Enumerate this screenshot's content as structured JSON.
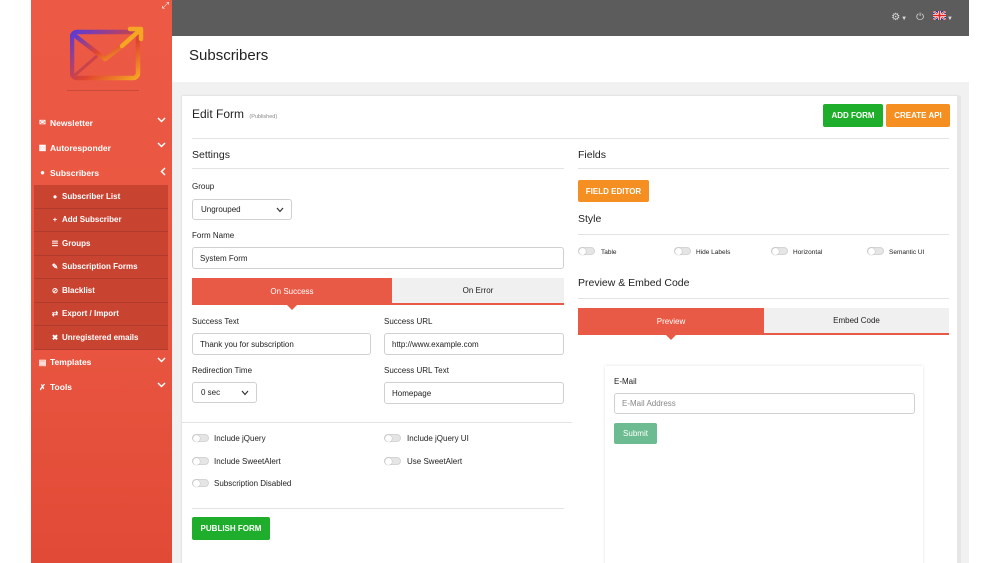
{
  "sidebar": {
    "nav": [
      {
        "label": "Newsletter",
        "icon": "envelope-icon"
      },
      {
        "label": "Autoresponder",
        "icon": "truck-icon"
      },
      {
        "label": "Subscribers",
        "icon": "users-icon"
      }
    ],
    "subscribers_sub": [
      {
        "label": "Subscriber List",
        "icon": "users-icon"
      },
      {
        "label": "Add Subscriber",
        "icon": "plus-icon"
      },
      {
        "label": "Groups",
        "icon": "list-icon"
      },
      {
        "label": "Subscription Forms",
        "icon": "edit-icon"
      },
      {
        "label": "Blacklist",
        "icon": "ban-icon"
      },
      {
        "label": "Export / Import",
        "icon": "exchange-icon"
      },
      {
        "label": "Unregistered emails",
        "icon": "user-times-icon"
      }
    ],
    "nav_after": [
      {
        "label": "Templates",
        "icon": "paint-roller-icon"
      },
      {
        "label": "Tools",
        "icon": "tools-icon"
      }
    ]
  },
  "page": {
    "title": "Subscribers"
  },
  "card": {
    "title": "Edit Form",
    "status": "(Published)",
    "add_form": "ADD FORM",
    "create_api": "CREATE API"
  },
  "settings": {
    "title": "Settings",
    "group_label": "Group",
    "group_value": "Ungrouped",
    "form_name_label": "Form Name",
    "form_name_value": "System Form",
    "tab_success": "On Success",
    "tab_error": "On Error",
    "success_text_label": "Success Text",
    "success_text_value": "Thank you for subscription",
    "success_url_label": "Success URL",
    "success_url_value": "http://www.example.com",
    "redirection_label": "Redirection Time",
    "redirection_value": "0 sec",
    "success_url_text_label": "Success URL Text",
    "success_url_text_value": "Homepage",
    "toggles": {
      "include_jquery": "Include jQuery",
      "include_jquery_ui": "Include jQuery UI",
      "include_sweetalert": "Include SweetAlert",
      "use_sweetalert": "Use SweetAlert",
      "subscription_disabled": "Subscription Disabled"
    },
    "publish": "PUBLISH FORM"
  },
  "fields": {
    "title": "Fields",
    "field_editor": "FIELD EDITOR",
    "style_title": "Style",
    "styles": [
      "Table",
      "Hide Labels",
      "Horizontal",
      "Semantic UI"
    ],
    "embed_title": "Preview & Embed Code",
    "tab_preview": "Preview",
    "tab_embed": "Embed Code",
    "email_label": "E-Mail",
    "email_placeholder": "E-Mail Address",
    "submit": "Submit"
  },
  "colors": {
    "accent": "#e85a45",
    "green": "#1fae2b",
    "orange": "#f58f21",
    "topbar": "#5c5c5c"
  }
}
